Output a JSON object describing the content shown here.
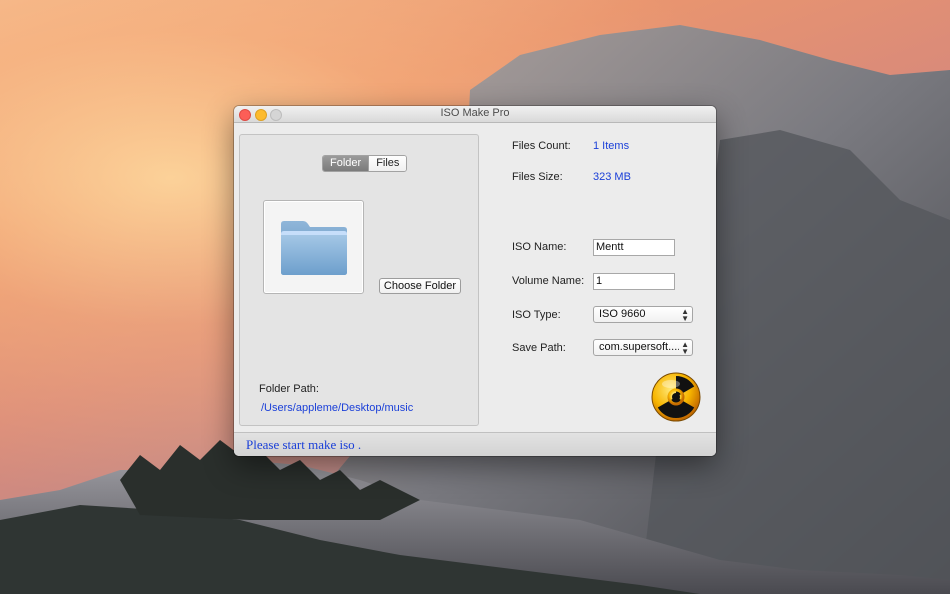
{
  "window": {
    "title": "ISO Make Pro"
  },
  "tabs": {
    "folder_label": "Folder",
    "files_label": "Files",
    "selected": "Folder"
  },
  "left_panel": {
    "folder_icon": "folder-icon",
    "choose_button": "Choose Folder",
    "folder_path_label": "Folder Path:",
    "folder_path_value": "/Users/appleme/Desktop/music"
  },
  "info": {
    "files_count_label": "Files Count:",
    "files_count_value": "1 Items",
    "files_size_label": "Files Size:",
    "files_size_value": "323 MB"
  },
  "form": {
    "iso_name_label": "ISO Name:",
    "iso_name_value": "Mentt",
    "volume_name_label": "Volume Name:",
    "volume_name_value": "1",
    "iso_type_label": "ISO Type:",
    "iso_type_value": "ISO 9660",
    "save_path_label": "Save Path:",
    "save_path_value": "com.supersoft...."
  },
  "action": {
    "icon": "radiation-icon"
  },
  "status": {
    "text": "Please start make iso ."
  },
  "colors": {
    "accent_blue": "#1a3fd8",
    "close": "#fc5e57",
    "minimize": "#fdbb2d"
  }
}
